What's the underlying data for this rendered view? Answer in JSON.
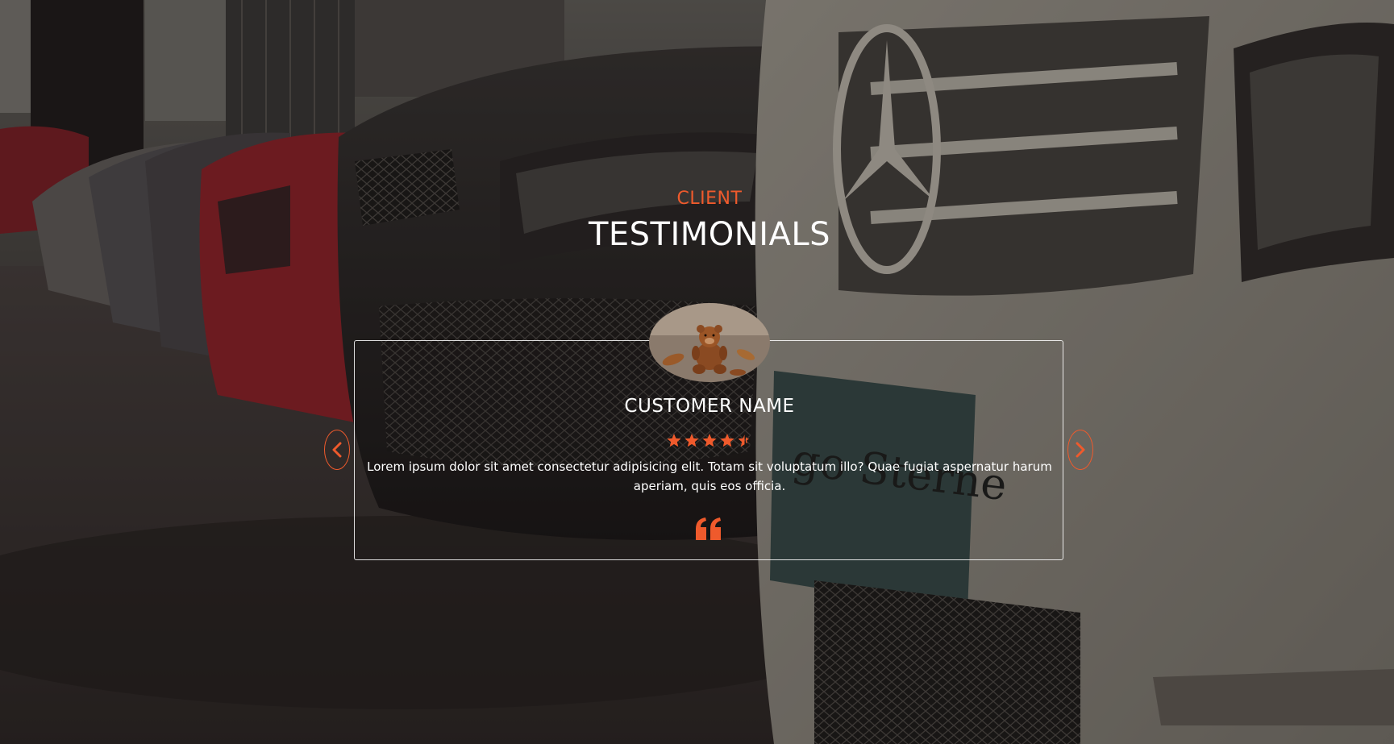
{
  "testimonials": {
    "kicker": "CLIENT",
    "heading": "TESTIMONIALS",
    "customer_name": "CUSTOMER NAME",
    "rating": 4.5,
    "rating_max": 5,
    "review": "Lorem ipsum dolor sit amet consectetur adipisicing elit. Totam sit voluptatum illo? Quae fugiat aspernatur harum aperiam, quis eos officia.",
    "avatar_icon": "teddy-bear-photo",
    "quote_icon": "quote-left-icon",
    "prev_icon": "chevron-left-icon",
    "next_icon": "chevron-right-icon"
  },
  "colors": {
    "accent": "#ef5a2c",
    "text": "#ffffff"
  }
}
